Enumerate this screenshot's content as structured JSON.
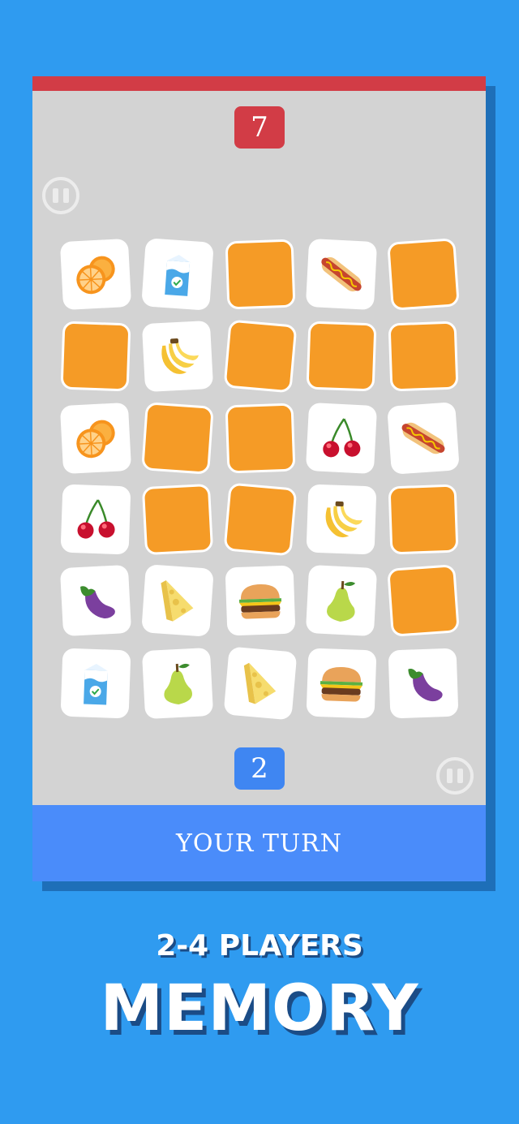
{
  "scores": {
    "opponent": "7",
    "player": "2"
  },
  "turn_label": "YOUR TURN",
  "subtitle": "2-4 PLAYERS",
  "title": "MEMORY",
  "colors": {
    "background": "#2f9bf0",
    "board": "#d3d3d3",
    "opponent": "#d23c46",
    "player": "#3f86f2",
    "card_back": "#f59b26",
    "card_face": "#ffffff"
  },
  "cards": [
    [
      "orange",
      "milk",
      "hidden",
      "hotdog",
      "hidden"
    ],
    [
      "hidden",
      "banana",
      "hidden",
      "hidden",
      "hidden"
    ],
    [
      "orange",
      "hidden",
      "hidden",
      "cherry",
      "hotdog"
    ],
    [
      "cherry",
      "hidden",
      "hidden",
      "banana",
      "hidden"
    ],
    [
      "eggplant",
      "cheese",
      "burger",
      "pear",
      "hidden"
    ],
    [
      "milk",
      "pear",
      "cheese",
      "burger",
      "eggplant"
    ]
  ]
}
